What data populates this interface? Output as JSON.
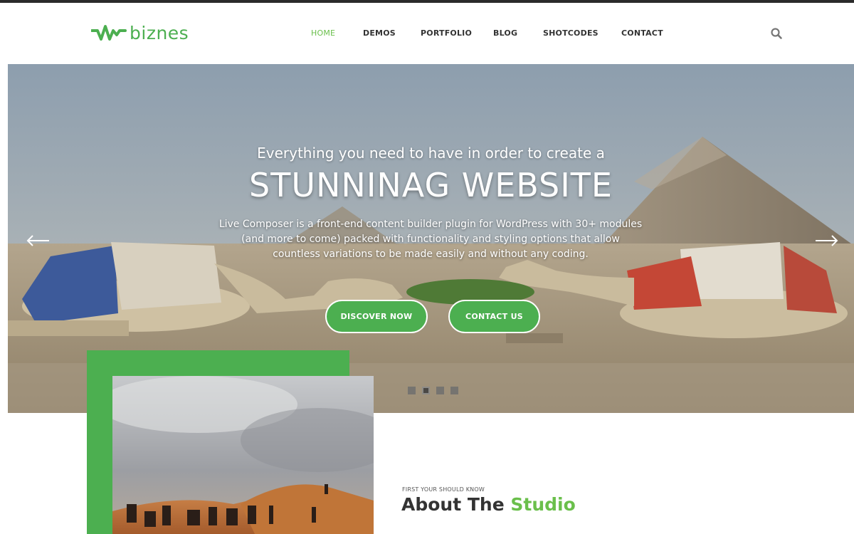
{
  "brand": {
    "name": "biznes",
    "logo_icon": "pulse-w-logo-icon",
    "color": "#4caf50"
  },
  "nav": {
    "items": [
      {
        "label": "HOME",
        "active": true
      },
      {
        "label": "DEMOS",
        "active": false
      },
      {
        "label": "PORTFOLIO",
        "active": false
      },
      {
        "label": "BLOG",
        "active": false
      },
      {
        "label": "SHOTCODES",
        "active": false
      },
      {
        "label": "CONTACT",
        "active": false
      }
    ],
    "search_icon": "search-icon",
    "active_color": "#6abf4b"
  },
  "hero": {
    "subtitle": "Everything you need to have in order to create a",
    "title": "STUNNINAG WEBSITE",
    "description": "Live Composer is a front-end content builder plugin for WordPress with 30+ modules (and more to come) packed with functionality and styling options that allow countless variations to be made easily and without any coding.",
    "buttons": {
      "discover": "DISCOVER NOW",
      "contact": "CONTACT US"
    },
    "slides": 4,
    "active_slide": 2,
    "prev_icon": "arrow-left-icon",
    "next_icon": "arrow-right-icon"
  },
  "about": {
    "kicker": "FIRST YOUR SHOULD KNOW",
    "title_part1": "About The ",
    "title_accent": "Studio"
  },
  "colors": {
    "accent": "#4caf50",
    "text_dark": "#333333"
  }
}
